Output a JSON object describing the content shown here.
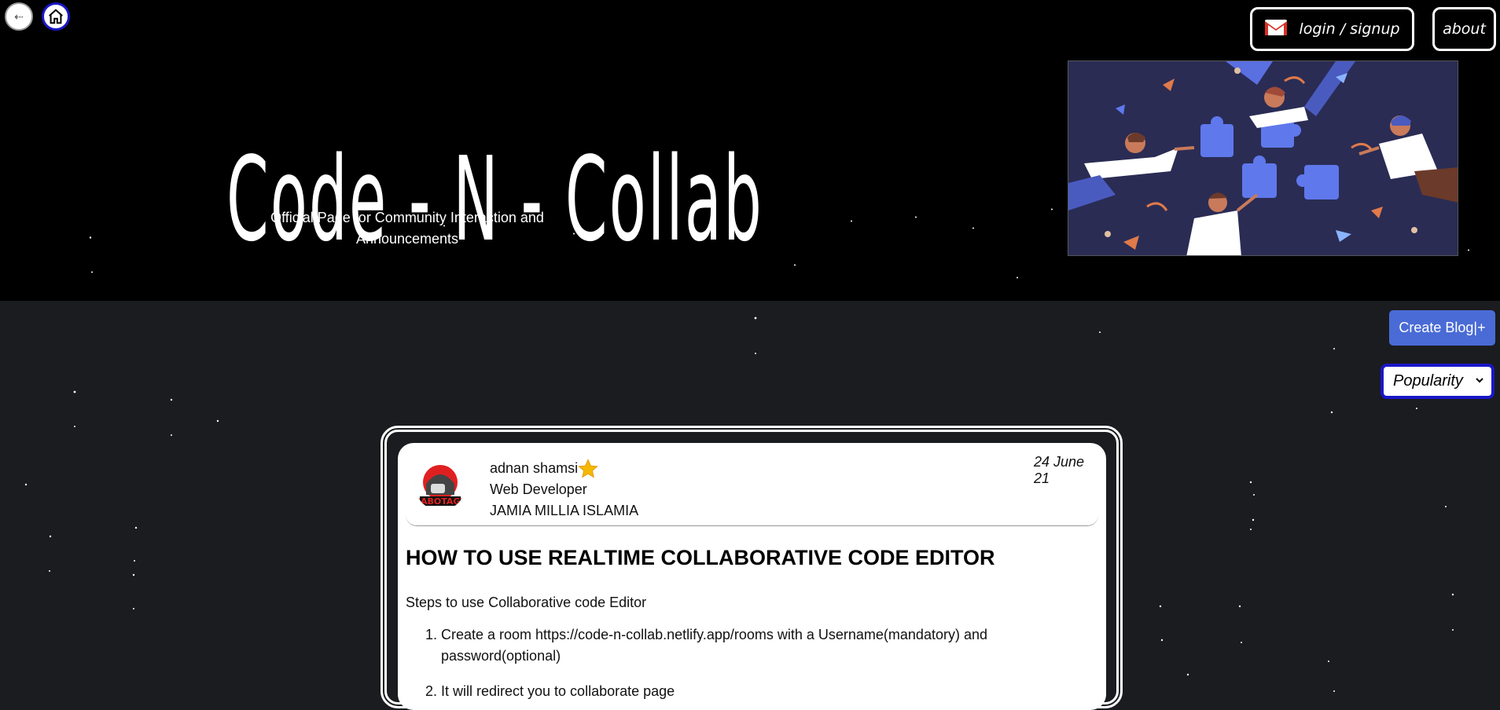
{
  "nav": {
    "back_icon": "arrow-left-icon",
    "home_icon": "home-icon"
  },
  "topbar": {
    "login_label": "login / signup",
    "login_icon": "gmail-icon",
    "about_label": "about"
  },
  "header": {
    "title": "Code - N - Collab",
    "subtitle": "Official Page for Community Interaction and Announcements"
  },
  "toolbar": {
    "create_blog_label": "Create Blog|+",
    "sort_selected": "Popularity"
  },
  "post": {
    "author_name": "adnan shamsi",
    "author_role": "Web Developer",
    "author_org": "JAMIA MILLIA ISLAMIA",
    "date": "24 June 21",
    "title": "HOW TO USE REALTIME COLLABORATIVE CODE EDITOR",
    "intro": "Steps to use Collaborative code Editor",
    "steps": [
      "Create a room https://code-n-collab.netlify.app/rooms with a Username(mandatory) and password(optional)",
      "It will redirect you to collaborate page"
    ]
  },
  "colors": {
    "header_bg": "#000000",
    "page_bg": "#1b1c1f",
    "accent_blue": "#4a6bd6",
    "focus_border": "#1a17c8"
  }
}
